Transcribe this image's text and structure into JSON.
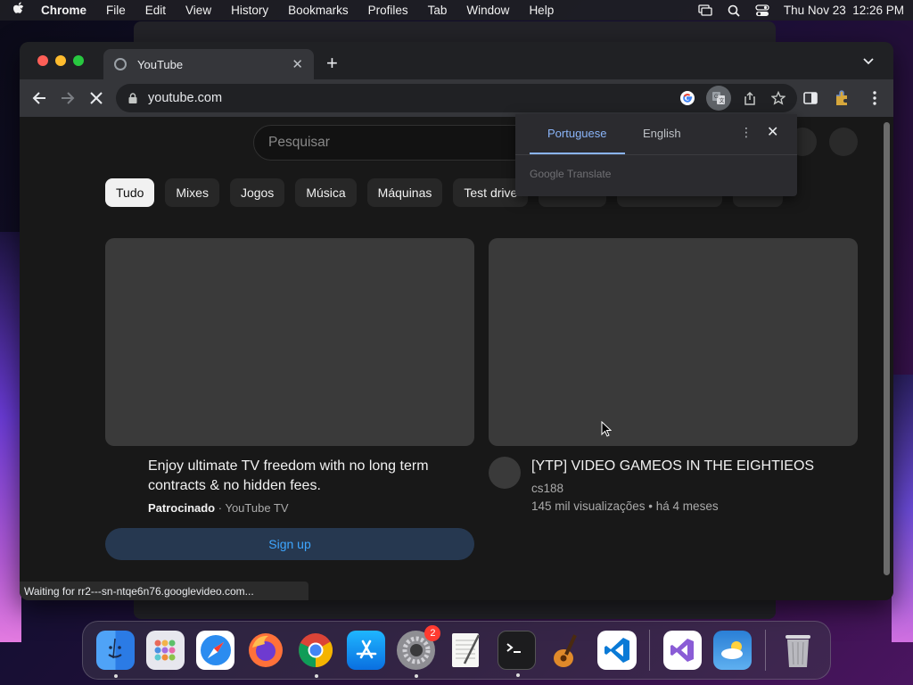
{
  "menubar": {
    "app_name": "Chrome",
    "items": [
      "File",
      "Edit",
      "View",
      "History",
      "Bookmarks",
      "Profiles",
      "Tab",
      "Window",
      "Help"
    ],
    "clock": "Thu Nov 23  12:26 PM"
  },
  "browser": {
    "tab_title": "YouTube",
    "url": "youtube.com",
    "status_text": "Waiting for rr2---sn-ntqe6n76.googlevideo.com..."
  },
  "youtube": {
    "search_placeholder": "Pesquisar",
    "chips": [
      "Tudo",
      "Mixes",
      "Jogos",
      "Música",
      "Máquinas",
      "Test drive"
    ],
    "ad": {
      "title": "Enjoy ultimate TV freedom with no long term contracts & no hidden fees.",
      "sponsored_label": "Patrocinado",
      "advertiser": "YouTube TV",
      "cta": "Sign up"
    },
    "video": {
      "title": "[YTP] VIDEO GAMEOS IN THE EIGHTIEOS",
      "channel": "cs188",
      "meta": "145 mil visualizações • há 4 meses"
    }
  },
  "translate_popup": {
    "source_language": "Portuguese",
    "target_language": "English",
    "brand": "Google Translate"
  },
  "dock": {
    "apps": [
      "Finder",
      "Launchpad",
      "Safari",
      "Firefox",
      "Google Chrome",
      "App Store",
      "System Settings",
      "TextEdit",
      "Terminal",
      "GarageBand",
      "Visual Studio Code",
      "Visual Studio",
      "Weather",
      "Trash"
    ],
    "settings_badge": "2"
  }
}
